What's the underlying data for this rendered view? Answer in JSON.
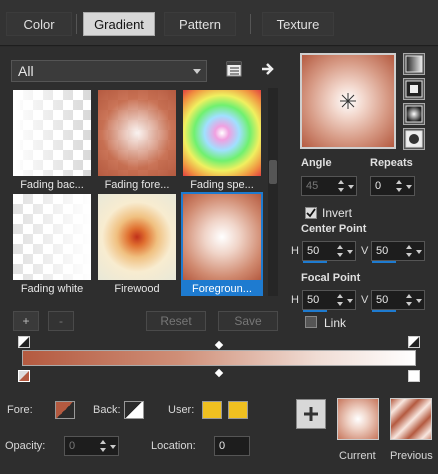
{
  "tabs": [
    {
      "label": "Color",
      "active": false
    },
    {
      "label": "Gradient",
      "active": true
    },
    {
      "label": "Pattern",
      "active": false
    },
    {
      "label": "Texture",
      "active": false
    }
  ],
  "library": {
    "selected": "All"
  },
  "thumbnails": [
    {
      "label": "Fading bac..."
    },
    {
      "label": "Fading fore..."
    },
    {
      "label": "Fading spe..."
    },
    {
      "label": "Fading white"
    },
    {
      "label": "Firewood"
    },
    {
      "label": "Foregroun...",
      "selected": true
    }
  ],
  "buttons": {
    "add": "+",
    "remove": "-",
    "reset": "Reset",
    "save": "Save"
  },
  "settings": {
    "angle_label": "Angle",
    "angle_value": "45",
    "repeats_label": "Repeats",
    "repeats_value": "0",
    "invert_label": "Invert",
    "invert_checked": true,
    "center_point_label": "Center Point",
    "center_h_label": "H",
    "center_h_value": "50",
    "center_v_label": "V",
    "center_v_value": "50",
    "focal_point_label": "Focal Point",
    "focal_h_label": "H",
    "focal_h_value": "50",
    "focal_v_label": "V",
    "focal_v_value": "50",
    "link_label": "Link",
    "link_checked": false
  },
  "footer": {
    "fore_label": "Fore:",
    "back_label": "Back:",
    "user_label": "User:",
    "opacity_label": "Opacity:",
    "opacity_value": "0",
    "location_label": "Location:",
    "location_value": "0",
    "current_label": "Current",
    "previous_label": "Previous"
  },
  "colors": {
    "accent": "#1e7bd0",
    "gradient_start": "#b45a40",
    "gradient_end": "#ffffff",
    "user_swatch": "#f0c020"
  }
}
